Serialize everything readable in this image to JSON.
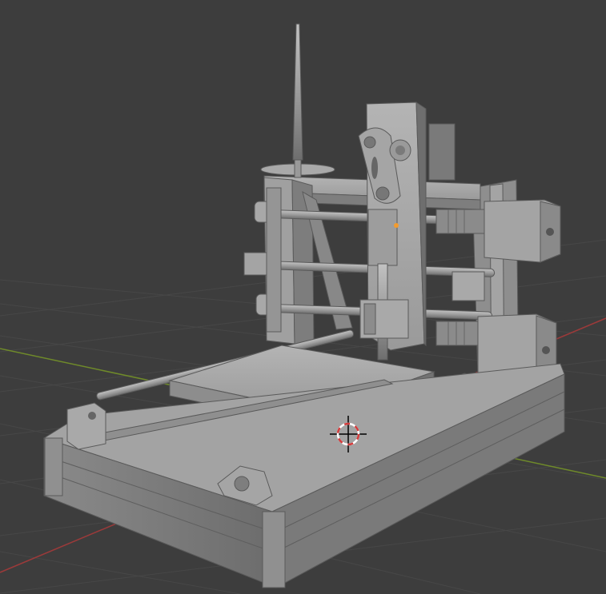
{
  "viewport": {
    "background": "#3d3d3d",
    "grid_color": "#474747",
    "x_axis_color": "#9b3a3a",
    "y_axis_color": "#6f8a2a",
    "model_color": "#9a9a9a",
    "cursor_icon": "3d-cursor-icon",
    "origin_icon": "object-origin-dot-icon"
  }
}
